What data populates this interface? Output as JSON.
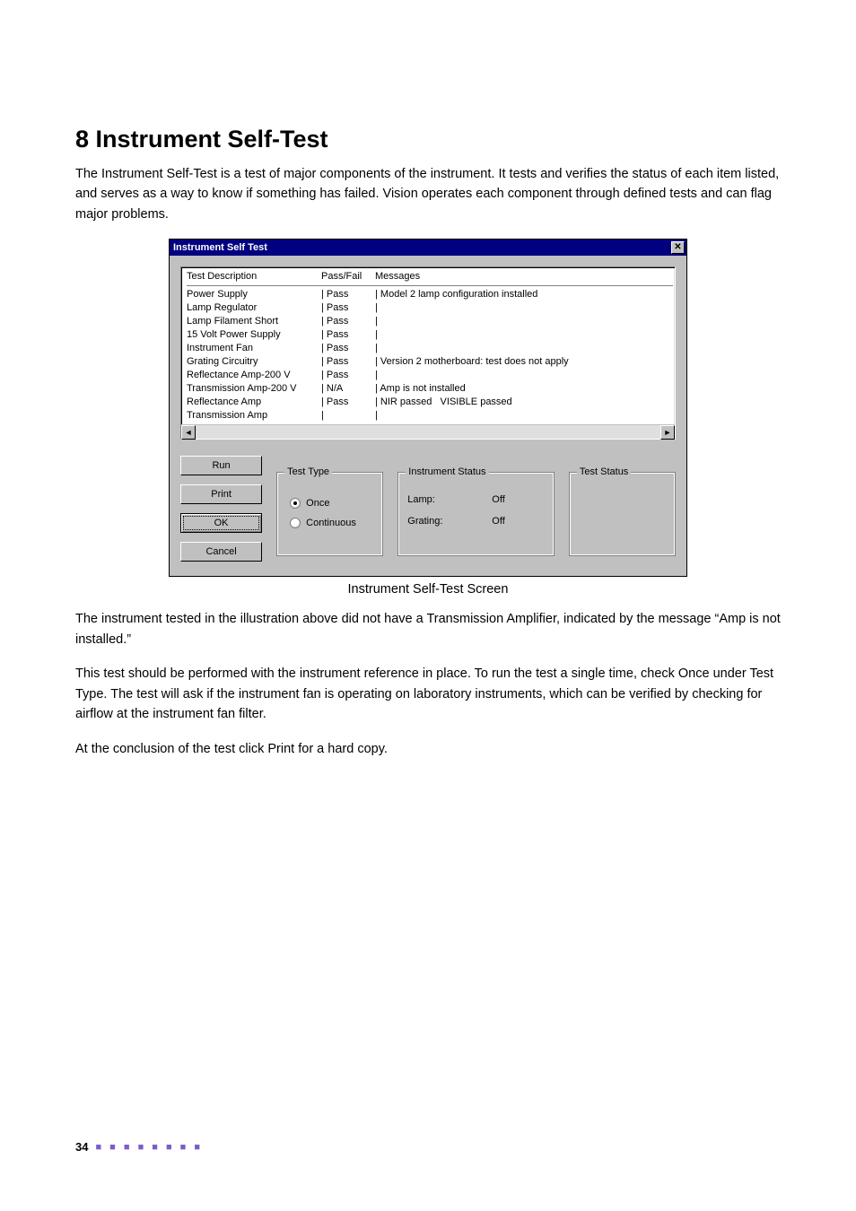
{
  "heading": "8   Instrument Self-Test",
  "para1": "The Instrument Self-Test is a test of major components of the instrument. It tests and verifies the status of each item listed, and serves as a way to know if something has failed. Vision operates each component through defined tests and can flag major problems.",
  "caption": "Instrument Self-Test Screen",
  "para2": "The instrument tested in the illustration above did not have a Transmission Amplifier, indicated by the message “Amp is not installed.”",
  "para3": "This test should be performed with the instrument reference in place. To run the test a single time, check Once under Test Type. The test will ask if the instrument fan is operating on laboratory instruments, which can be verified by checking for airflow at the instrument fan filter.",
  "para4": "At the conclusion of the test click Print for a hard copy.",
  "page_number": "34",
  "dialog": {
    "title": "Instrument Self Test",
    "headers": {
      "desc": "Test Description",
      "pf": "Pass/Fail",
      "msg": "Messages"
    },
    "rows": [
      {
        "desc": "Power Supply",
        "pf": "Pass",
        "msg": "Model 2 lamp configuration installed"
      },
      {
        "desc": "Lamp Regulator",
        "pf": "Pass",
        "msg": ""
      },
      {
        "desc": "Lamp Filament Short",
        "pf": "Pass",
        "msg": ""
      },
      {
        "desc": "15 Volt Power Supply",
        "pf": "Pass",
        "msg": ""
      },
      {
        "desc": "Instrument Fan",
        "pf": "Pass",
        "msg": ""
      },
      {
        "desc": "Grating Circuitry",
        "pf": "Pass",
        "msg": "Version 2 motherboard: test does not apply"
      },
      {
        "desc": "Reflectance Amp-200 V",
        "pf": "Pass",
        "msg": ""
      },
      {
        "desc": "Transmission Amp-200 V",
        "pf": "N/A",
        "msg": "Amp is not installed"
      },
      {
        "desc": "Reflectance Amp",
        "pf": "Pass",
        "msg": "NIR passed   VISIBLE passed"
      },
      {
        "desc": "Transmission Amp",
        "pf": "",
        "msg": ""
      }
    ],
    "buttons": {
      "run": "Run",
      "print": "Print",
      "ok": "OK",
      "cancel": "Cancel"
    },
    "test_type": {
      "legend": "Test Type",
      "once": "Once",
      "continuous": "Continuous",
      "selected": "once"
    },
    "instrument_status": {
      "legend": "Instrument Status",
      "lamp_label": "Lamp:",
      "lamp_value": "Off",
      "grating_label": "Grating:",
      "grating_value": "Off"
    },
    "test_status": {
      "legend": "Test Status"
    }
  }
}
